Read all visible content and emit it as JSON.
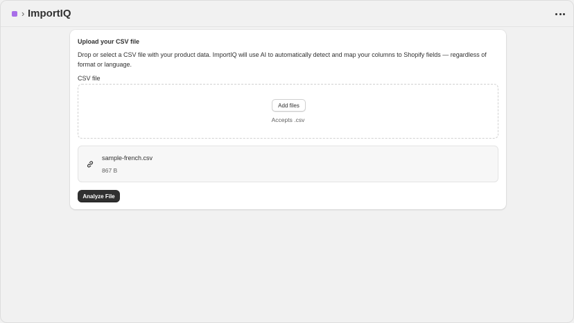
{
  "header": {
    "app_icon": "app-icon",
    "separator": "›",
    "title": "ImportIQ",
    "menu_icon": "more-horizontal-icon"
  },
  "card": {
    "title": "Upload your CSV file",
    "description": "Drop or select a CSV file with your product data. ImportIQ will use AI to automatically detect and map your columns to Shopify fields — regardless of format or language.",
    "field_label": "CSV file",
    "dropzone": {
      "button_label": "Add files",
      "accepts_text": "Accepts .csv"
    },
    "file": {
      "icon": "paperclip-icon",
      "name": "sample-french.csv",
      "size": "867 B"
    },
    "analyze_label": "Analyze File"
  },
  "colors": {
    "accent": "#a86ee8",
    "primary_button": "#303030",
    "background": "#f1f1f1"
  }
}
